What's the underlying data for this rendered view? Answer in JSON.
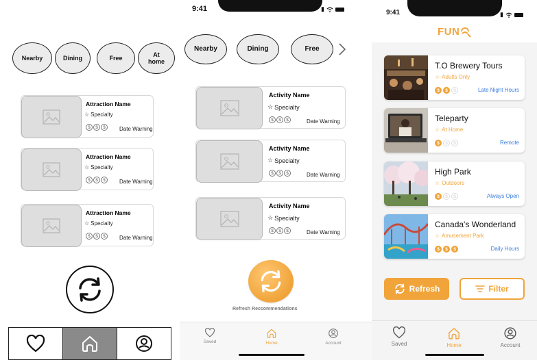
{
  "panel1": {
    "chips": [
      {
        "label": "Nearby"
      },
      {
        "label": "Dining"
      },
      {
        "label": "Free"
      },
      {
        "label": "At\nhome"
      }
    ],
    "cards": [
      {
        "title": "Attraction Name",
        "specialty": "Specialty",
        "date": "Date Warning"
      },
      {
        "title": "Attraction Name",
        "specialty": "Specialty",
        "date": "Date Warning"
      },
      {
        "title": "Attraction Name",
        "specialty": "Specialty",
        "date": "Date Warning"
      }
    ],
    "coin_symbol": "$"
  },
  "panel2": {
    "time": "9:41",
    "chips": [
      {
        "label": "Nearby"
      },
      {
        "label": "Dining"
      },
      {
        "label": "Free"
      }
    ],
    "cards": [
      {
        "title": "Activity Name",
        "specialty": "Specialty",
        "date": "Date Warning"
      },
      {
        "title": "Activity Name",
        "specialty": "Specialty",
        "date": "Date Warning"
      },
      {
        "title": "Activity Name",
        "specialty": "Specialty",
        "date": "Date Warning"
      }
    ],
    "refresh_label": "Refresh Reccommendations",
    "tabs": [
      {
        "label": "Saved",
        "icon": "heart-icon"
      },
      {
        "label": "Home",
        "icon": "home-icon",
        "active": true
      },
      {
        "label": "Account",
        "icon": "account-icon"
      }
    ]
  },
  "panel3": {
    "time": "9:41",
    "logo_text": "FUN",
    "cards": [
      {
        "title": "T.O Brewery Tours",
        "category": "Adults Only",
        "price_level": 2,
        "time": "Late Night Hours"
      },
      {
        "title": "Teleparty",
        "category": "At Home",
        "price_level": 1,
        "time": "Remote"
      },
      {
        "title": "High Park",
        "category": "Outdoors",
        "price_level": 1,
        "time": "Always Open"
      },
      {
        "title": "Canada's Wonderland",
        "category": "Amusement Park",
        "price_level": 3,
        "time": "Daily Hours"
      }
    ],
    "refresh_button": "Refresh",
    "filter_button": "Filter",
    "tabs": [
      {
        "label": "Saved",
        "icon": "heart-icon"
      },
      {
        "label": "Home",
        "icon": "home-icon",
        "active": true
      },
      {
        "label": "Account",
        "icon": "account-icon"
      }
    ]
  },
  "colors": {
    "accent": "#f0a43a",
    "link": "#3b7ddd",
    "nav_active_gray": "#8a8a8a"
  }
}
